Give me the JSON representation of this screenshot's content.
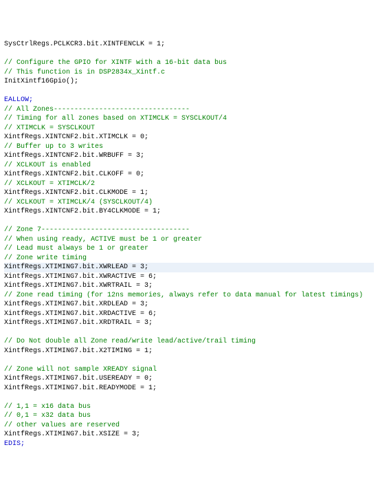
{
  "lines": [
    {
      "segments": [
        {
          "text": "SysCtrlRegs.PCLKCR3.bit.XINTFENCLK = 1;",
          "cls": ""
        }
      ]
    },
    {
      "segments": [
        {
          "text": " ",
          "cls": ""
        }
      ]
    },
    {
      "segments": [
        {
          "text": "// Configure the GPIO for XINTF with a 16-bit data bus",
          "cls": "comment"
        }
      ]
    },
    {
      "segments": [
        {
          "text": "// This function is in DSP2834x_Xintf.c",
          "cls": "comment"
        }
      ]
    },
    {
      "segments": [
        {
          "text": "InitXintf16Gpio();",
          "cls": ""
        }
      ]
    },
    {
      "segments": [
        {
          "text": " ",
          "cls": ""
        }
      ]
    },
    {
      "segments": [
        {
          "text": "EALLOW;",
          "cls": "keyword"
        }
      ]
    },
    {
      "segments": [
        {
          "text": "// All Zones---------------------------------",
          "cls": "comment"
        }
      ]
    },
    {
      "segments": [
        {
          "text": "// Timing for all zones based on XTIMCLK = SYSCLKOUT/4",
          "cls": "comment"
        }
      ]
    },
    {
      "segments": [
        {
          "text": "// XTIMCLK = SYSCLKOUT",
          "cls": "comment"
        }
      ]
    },
    {
      "segments": [
        {
          "text": "XintfRegs.XINTCNF2.bit.XTIMCLK = 0;",
          "cls": ""
        }
      ]
    },
    {
      "segments": [
        {
          "text": "// Buffer up to 3 writes",
          "cls": "comment"
        }
      ]
    },
    {
      "segments": [
        {
          "text": "XintfRegs.XINTCNF2.bit.WRBUFF = 3;",
          "cls": ""
        }
      ]
    },
    {
      "segments": [
        {
          "text": "// XCLKOUT is enabled",
          "cls": "comment"
        }
      ]
    },
    {
      "segments": [
        {
          "text": "XintfRegs.XINTCNF2.bit.CLKOFF = 0;",
          "cls": ""
        }
      ]
    },
    {
      "segments": [
        {
          "text": "// XCLKOUT = XTIMCLK/2",
          "cls": "comment"
        }
      ]
    },
    {
      "segments": [
        {
          "text": "XintfRegs.XINTCNF2.bit.CLKMODE = 1;",
          "cls": ""
        }
      ]
    },
    {
      "segments": [
        {
          "text": "// XCLKOUT = XTIMCLK/4 (SYSCLKOUT/4)",
          "cls": "comment"
        }
      ]
    },
    {
      "segments": [
        {
          "text": "XintfRegs.XINTCNF2.bit.BY4CLKMODE = 1;",
          "cls": ""
        }
      ]
    },
    {
      "segments": [
        {
          "text": " ",
          "cls": ""
        }
      ]
    },
    {
      "segments": [
        {
          "text": "// Zone 7------------------------------------",
          "cls": "comment"
        }
      ]
    },
    {
      "segments": [
        {
          "text": "// When using ready, ACTIVE must be 1 or greater",
          "cls": "comment"
        }
      ]
    },
    {
      "segments": [
        {
          "text": "// Lead must always be 1 or greater",
          "cls": "comment"
        }
      ]
    },
    {
      "segments": [
        {
          "text": "// Zone write timing",
          "cls": "comment"
        }
      ]
    },
    {
      "segments": [
        {
          "text": "XintfRegs.XTIMING7.bit.XWRLEAD = 3;",
          "cls": ""
        }
      ],
      "hl": true
    },
    {
      "segments": [
        {
          "text": "XintfRegs.XTIMING7.bit.XWRACTIVE = 6;",
          "cls": ""
        }
      ]
    },
    {
      "segments": [
        {
          "text": "XintfRegs.XTIMING7.bit.XWRTRAIL = 3;",
          "cls": ""
        }
      ]
    },
    {
      "segments": [
        {
          "text": "// Zone read timing (for 12ns memories, always refer to data manual for latest timings)",
          "cls": "comment"
        }
      ]
    },
    {
      "segments": [
        {
          "text": "XintfRegs.XTIMING7.bit.XRDLEAD = 3;",
          "cls": ""
        }
      ]
    },
    {
      "segments": [
        {
          "text": "XintfRegs.XTIMING7.bit.XRDACTIVE = 6;",
          "cls": ""
        }
      ]
    },
    {
      "segments": [
        {
          "text": "XintfRegs.XTIMING7.bit.XRDTRAIL = 3;",
          "cls": ""
        }
      ]
    },
    {
      "segments": [
        {
          "text": " ",
          "cls": ""
        }
      ]
    },
    {
      "segments": [
        {
          "text": "// Do Not double all Zone read/write lead/active/trail timing",
          "cls": "comment"
        }
      ]
    },
    {
      "segments": [
        {
          "text": "XintfRegs.XTIMING7.bit.X2TIMING = 1;",
          "cls": ""
        }
      ]
    },
    {
      "segments": [
        {
          "text": " ",
          "cls": ""
        }
      ]
    },
    {
      "segments": [
        {
          "text": "// Zone will not sample XREADY signal",
          "cls": "comment"
        }
      ]
    },
    {
      "segments": [
        {
          "text": "XintfRegs.XTIMING7.bit.USEREADY = 0;",
          "cls": ""
        }
      ]
    },
    {
      "segments": [
        {
          "text": "XintfRegs.XTIMING7.bit.READYMODE = 1;",
          "cls": ""
        }
      ]
    },
    {
      "segments": [
        {
          "text": " ",
          "cls": ""
        }
      ]
    },
    {
      "segments": [
        {
          "text": "// 1,1 = x16 data bus",
          "cls": "comment"
        }
      ]
    },
    {
      "segments": [
        {
          "text": "// 0,1 = x32 data bus",
          "cls": "comment"
        }
      ]
    },
    {
      "segments": [
        {
          "text": "// other values are reserved",
          "cls": "comment"
        }
      ]
    },
    {
      "segments": [
        {
          "text": "XintfRegs.XTIMING7.bit.XSIZE = 3;",
          "cls": ""
        }
      ]
    },
    {
      "segments": [
        {
          "text": "EDIS;",
          "cls": "keyword"
        }
      ]
    }
  ]
}
